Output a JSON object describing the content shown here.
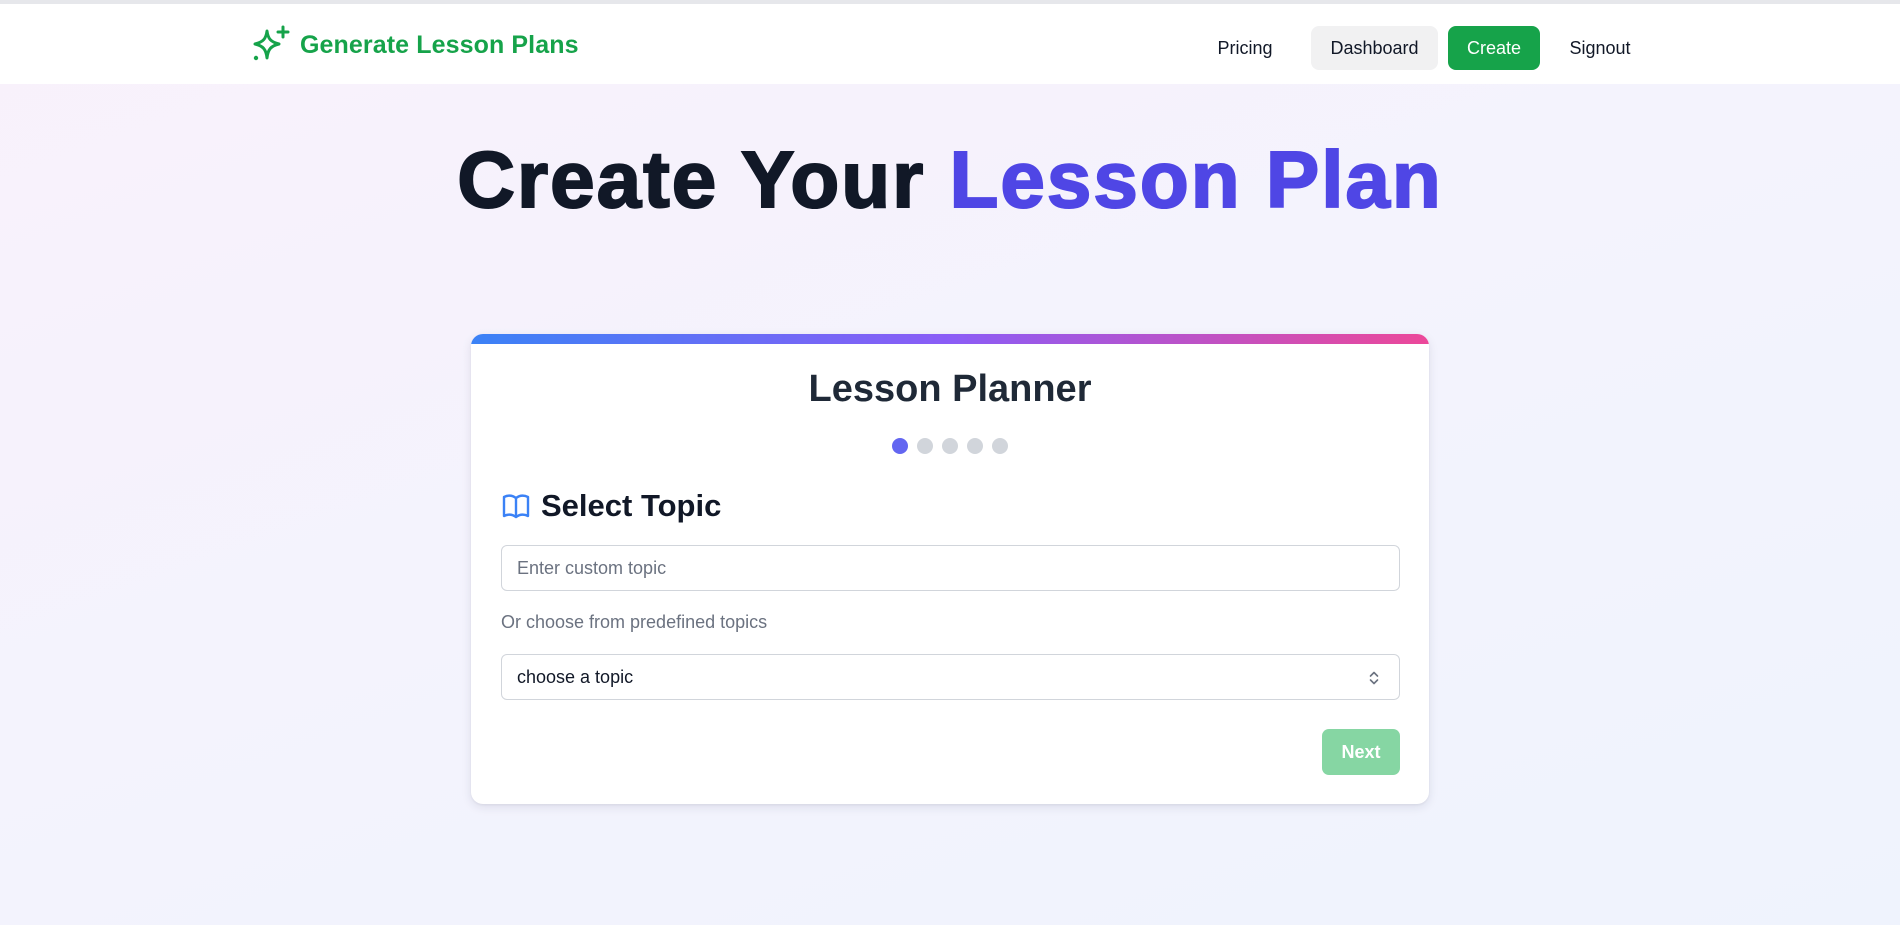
{
  "brand": {
    "name": "Generate Lesson Plans",
    "icon": "sparkles-icon",
    "color": "#16a34a"
  },
  "nav": {
    "pricing": "Pricing",
    "dashboard": "Dashboard",
    "create": "Create",
    "signout": "Signout"
  },
  "hero": {
    "title_part1": "Create Your ",
    "title_accent": "Lesson Plan",
    "accent_color": "#4f46e5"
  },
  "card": {
    "title": "Lesson Planner",
    "steps": {
      "total": 5,
      "current": 1
    },
    "section": {
      "icon": "book-open-icon",
      "title": "Select Topic"
    },
    "custom_topic": {
      "placeholder": "Enter custom topic",
      "value": ""
    },
    "or_label": "Or choose from predefined topics",
    "topic_select": {
      "selected": "choose a topic"
    },
    "next_label": "Next",
    "next_disabled": true
  },
  "colors": {
    "primary_green": "#16a34a",
    "accent_indigo": "#4f46e5",
    "active_step": "#6366f1",
    "gradient": [
      "#3b82f6",
      "#8b5cf6",
      "#ec4899"
    ]
  }
}
